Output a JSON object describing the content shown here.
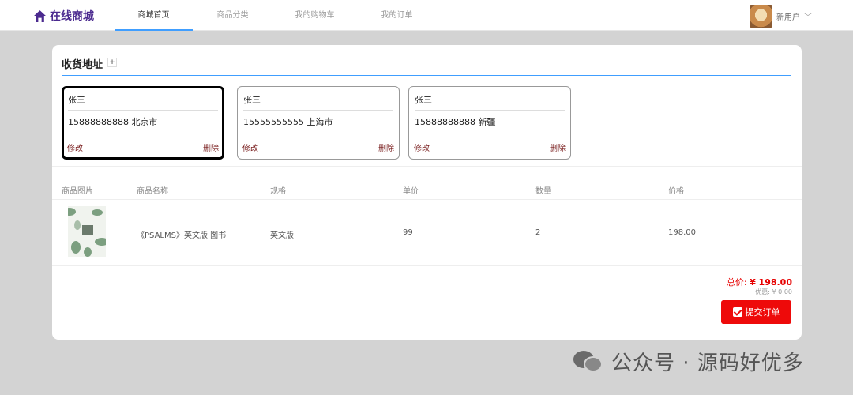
{
  "nav": {
    "logo": "在线商城",
    "items": [
      {
        "label": "商城首页",
        "active": true
      },
      {
        "label": "商品分类",
        "active": false
      },
      {
        "label": "我的购物车",
        "active": false
      },
      {
        "label": "我的订单",
        "active": false
      }
    ],
    "user": {
      "name": "新用户"
    }
  },
  "address_section": {
    "title": "收货地址",
    "add_label": "+",
    "addresses": [
      {
        "name": "张三",
        "line": "15888888888 北京市",
        "edit": "修改",
        "delete": "删除",
        "selected": true
      },
      {
        "name": "张三",
        "line": "15555555555 上海市",
        "edit": "修改",
        "delete": "删除",
        "selected": false
      },
      {
        "name": "张三",
        "line": "15888888888 新疆",
        "edit": "修改",
        "delete": "删除",
        "selected": false
      }
    ]
  },
  "table": {
    "headers": [
      "商品图片",
      "商品名称",
      "规格",
      "单价",
      "数量",
      "价格"
    ],
    "rows": [
      {
        "name": "《PSALMS》英文版 图书",
        "spec": "英文版",
        "unit_price": "99",
        "quantity": "2",
        "price": "198.00"
      }
    ]
  },
  "summary": {
    "total_label": "总价:",
    "total_amount": "¥ 198.00",
    "discount_label": "优惠:",
    "discount_amount": "¥ 0.00",
    "submit_label": "提交订单"
  },
  "watermark": "公众号 · 源码好优多",
  "colors": {
    "accent": "#409eff",
    "logo": "#4b2a8f",
    "danger": "#ee0a0a",
    "link": "#7a1f1f"
  }
}
